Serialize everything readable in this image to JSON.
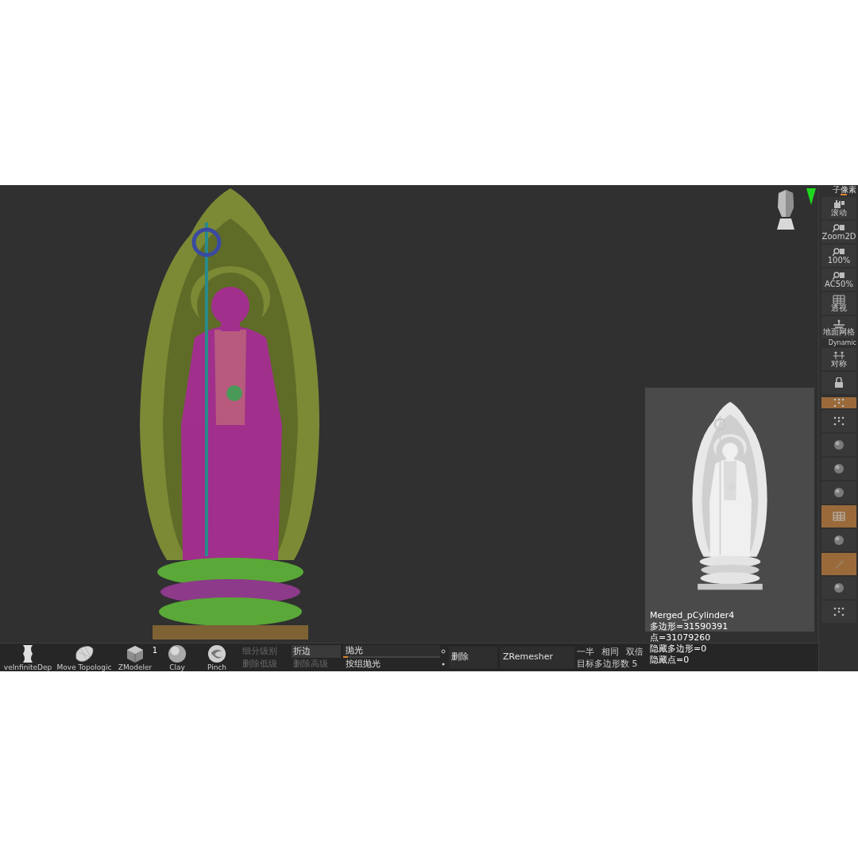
{
  "sidebar": {
    "title": "子像素",
    "items": [
      {
        "kind": "button",
        "label": "滚动",
        "selected": false
      },
      {
        "kind": "button",
        "label": "Zoom2D",
        "selected": false
      },
      {
        "kind": "button",
        "label": "100%",
        "selected": false
      },
      {
        "kind": "button",
        "label": "AC50%",
        "selected": false
      },
      {
        "kind": "button",
        "label": "透视",
        "selected": false
      },
      {
        "kind": "button",
        "label": "地面网格",
        "selected": false
      },
      {
        "kind": "caption",
        "label": "Dynamic"
      },
      {
        "kind": "button",
        "label": "对称",
        "selected": false
      },
      {
        "kind": "button",
        "selected": false
      },
      {
        "kind": "small",
        "selected": true
      },
      {
        "kind": "button",
        "selected": false
      },
      {
        "kind": "button",
        "selected": false
      },
      {
        "kind": "button",
        "selected": false
      },
      {
        "kind": "button",
        "selected": false
      },
      {
        "kind": "button",
        "selected": true
      },
      {
        "kind": "button",
        "selected": false
      },
      {
        "kind": "button",
        "selected": true
      },
      {
        "kind": "button",
        "selected": false
      },
      {
        "kind": "button",
        "selected": false
      }
    ]
  },
  "toolbar": {
    "brushes": [
      {
        "label": "veInfiniteDep"
      },
      {
        "label": "Move Topologic"
      },
      {
        "label": "ZModeler"
      },
      {
        "label": "Clay"
      },
      {
        "label": "Pinch"
      }
    ],
    "brush_count": "1",
    "subdivision": [
      {
        "label": "细分级别",
        "disabled": true
      },
      {
        "label": "折边",
        "disabled": false
      },
      {
        "label": "删除低级",
        "disabled": true
      },
      {
        "label": "删除高级",
        "disabled": true
      }
    ],
    "polish": {
      "label": "抛光",
      "level": 0.05
    },
    "polish_groups": "按组抛光",
    "delete": "删除",
    "zremesher": "ZRemesher",
    "target_options": [
      {
        "label": "一半"
      },
      {
        "label": "相同"
      },
      {
        "label": "双倍"
      }
    ],
    "target_polys": "目标多边形数 5"
  },
  "info": [
    "Merged_pCylinder4",
    "多边形=31590391",
    "点=31079260",
    "隐藏多边形=0",
    "隐藏点=0"
  ]
}
